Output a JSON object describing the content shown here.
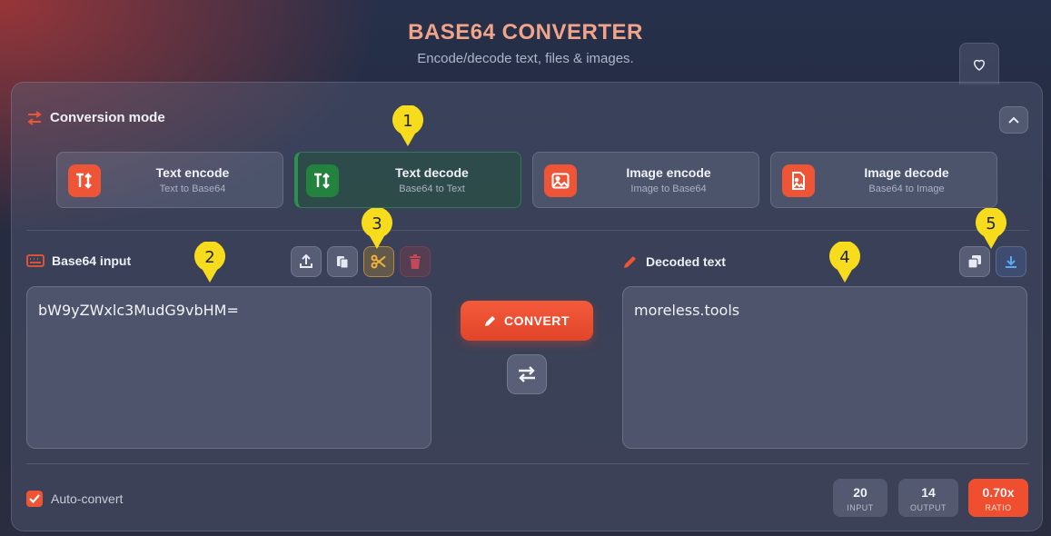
{
  "header": {
    "title": "BASE64 CONVERTER",
    "subtitle": "Encode/decode text, files & images."
  },
  "mode_section": {
    "label": "Conversion mode"
  },
  "modes": [
    {
      "title": "Text encode",
      "subtitle": "Text to Base64",
      "icon": "text-swap-icon"
    },
    {
      "title": "Text decode",
      "subtitle": "Base64 to Text",
      "icon": "text-swap-icon",
      "active": true
    },
    {
      "title": "Image encode",
      "subtitle": "Image to Base64",
      "icon": "image-icon"
    },
    {
      "title": "Image decode",
      "subtitle": "Base64 to Image",
      "icon": "image-file-icon"
    }
  ],
  "input": {
    "label": "Base64 input",
    "value": "bW9yZWxlc3MudG9vbHM="
  },
  "output": {
    "label": "Decoded text",
    "value": "moreless.tools"
  },
  "actions": {
    "convert_label": "CONVERT"
  },
  "auto_convert": {
    "label": "Auto-convert",
    "checked": true
  },
  "stats": [
    {
      "value": "20",
      "label": "INPUT"
    },
    {
      "value": "14",
      "label": "OUTPUT"
    },
    {
      "value": "0.70x",
      "label": "RATIO"
    }
  ],
  "markers": [
    "1",
    "2",
    "3",
    "4",
    "5"
  ],
  "colors": {
    "accent": "#ef5535",
    "active_mode": "#22823e",
    "marker": "#f7dc1e",
    "title": "#f2a48a"
  }
}
